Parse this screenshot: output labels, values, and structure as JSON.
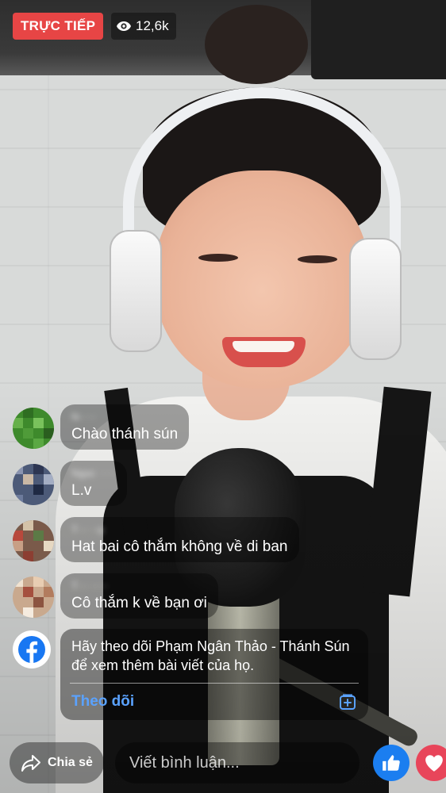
{
  "live": {
    "label": "TRỰC TIẾP",
    "viewer_count": "12,6k",
    "viewer_icon": "eye-icon",
    "badge_color": "#e74545"
  },
  "comments": [
    {
      "author": "N·····",
      "text": "Chào thánh sún"
    },
    {
      "author": "Ngọc ·····",
      "text": "L.v"
    },
    {
      "author": "T··· ··ụ",
      "text": "Hat bai cô thắm không về di ban"
    },
    {
      "author": "T··· ·····",
      "text": "Cô thắm k về bạn ơi"
    }
  ],
  "follow_card": {
    "icon": "facebook-icon",
    "message": "Hãy theo dõi Phạm Ngân Thảo - Thánh Sún để xem thêm bài viết của họ.",
    "follow_label": "Theo dõi",
    "save_icon": "bookmark-icon"
  },
  "bottom_bar": {
    "share_label": "Chia sẻ",
    "share_icon": "share-arrow-icon",
    "comment_placeholder": "Viết bình luận...",
    "like_icon": "thumbs-up-icon",
    "love_icon": "heart-icon",
    "like_color": "#1b7ef0",
    "love_color": "#e8455a"
  },
  "colors": {
    "facebook_blue": "#1877f2",
    "follow_link": "#5aa2ff"
  }
}
